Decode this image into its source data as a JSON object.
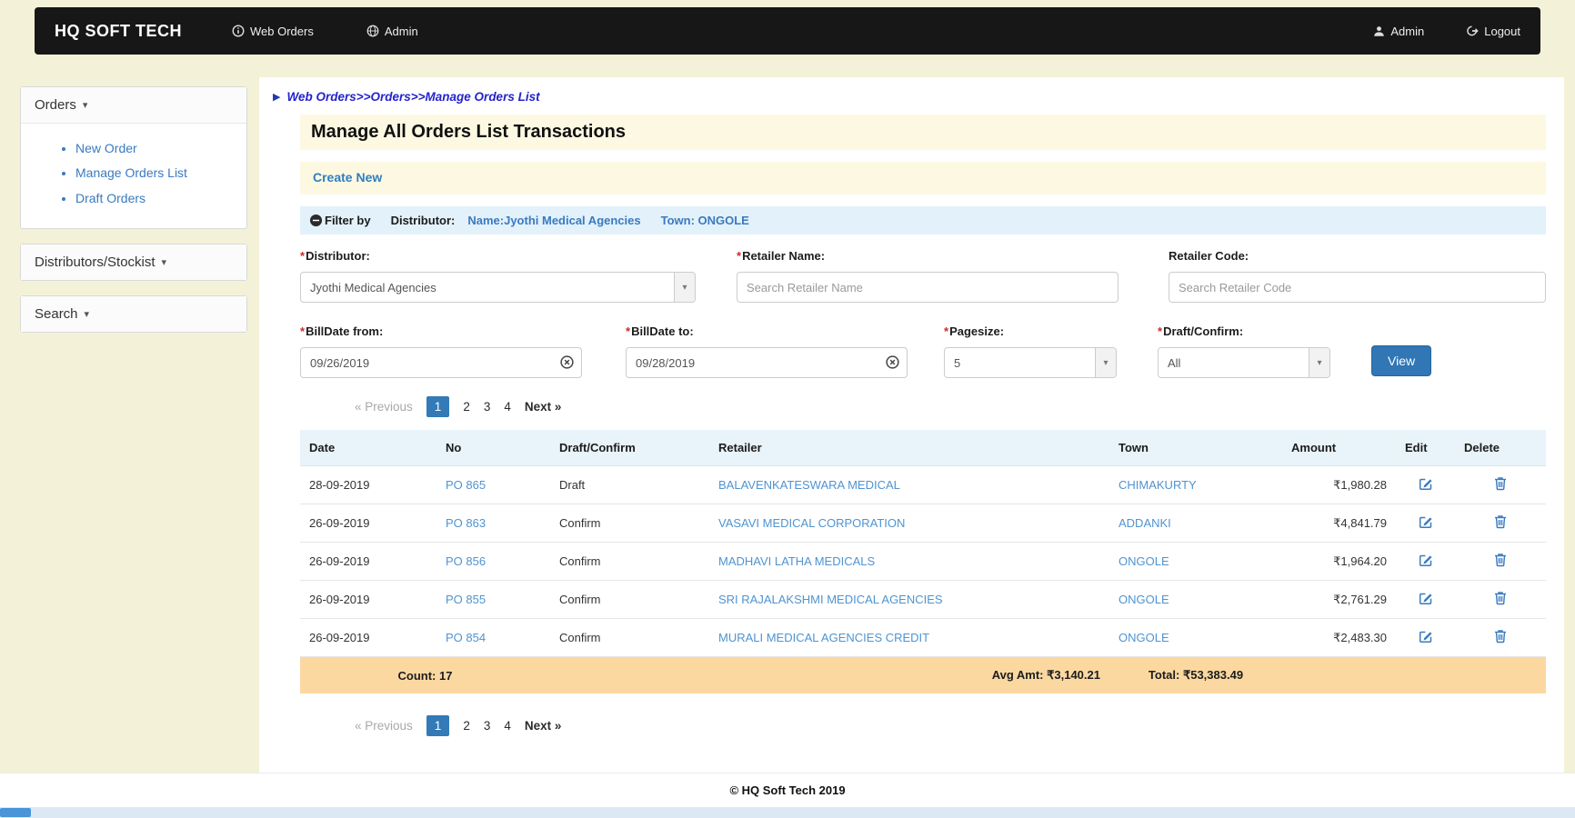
{
  "colors": {
    "accent": "#337ab7",
    "navbar_bg": "#171717",
    "page_bg": "#f3f2d8",
    "strip_bg": "#fdf8e1",
    "filter_bg": "#e3f1fa",
    "table_header_bg": "#e8f3fa",
    "summary_row_bg": "#fcd8a1",
    "link": "#4f94d0",
    "required_mark_color": "#cc2a2a"
  },
  "icons": {
    "caret_down": "▾",
    "breadcrumb_arrow": "▶"
  },
  "navbar": {
    "brand": "HQ SOFT TECH",
    "web_orders": "Web Orders",
    "admin_menu": "Admin",
    "admin_user": "Admin",
    "logout": "Logout"
  },
  "sidebar": {
    "orders": {
      "title": "Orders",
      "items": [
        {
          "label": "New Order"
        },
        {
          "label": "Manage Orders List"
        },
        {
          "label": "Draft Orders"
        }
      ]
    },
    "distributors": {
      "title": "Distributors/Stockist"
    },
    "search": {
      "title": "Search"
    }
  },
  "breadcrumb": "Web Orders>>Orders>>Manage Orders List",
  "page": {
    "title": "Manage All Orders List Transactions",
    "create_new": "Create New"
  },
  "filter": {
    "label": "Filter by",
    "distributor_label": "Distributor:",
    "name_value": "Name:Jyothi Medical Agencies",
    "town_value": "Town: ONGOLE"
  },
  "form": {
    "required_mark": "*",
    "distributor": {
      "label": "Distributor:",
      "value": "Jyothi Medical Agencies"
    },
    "retailer_name": {
      "label": "Retailer Name:",
      "placeholder": "Search Retailer Name"
    },
    "retailer_code": {
      "label": "Retailer Code:",
      "placeholder": "Search Retailer Code"
    },
    "bill_date_from": {
      "label": "BillDate from:",
      "value": "09/26/2019"
    },
    "bill_date_to": {
      "label": "BillDate to:",
      "value": "09/28/2019"
    },
    "pagesize": {
      "label": "Pagesize:",
      "value": "5"
    },
    "draft_confirm": {
      "label": "Draft/Confirm:",
      "value": "All"
    },
    "view_button": "View"
  },
  "pagination": {
    "previous": "« Previous",
    "pages": [
      "1",
      "2",
      "3",
      "4"
    ],
    "next": "Next »",
    "active_page": "1"
  },
  "orders_table": {
    "headers": [
      "Date",
      "No",
      "Draft/Confirm",
      "Retailer",
      "Town",
      "Amount",
      "Edit",
      "Delete"
    ],
    "rows": [
      {
        "date": "28-09-2019",
        "no": "PO 865",
        "status": "Draft",
        "retailer": "BALAVENKATESWARA MEDICAL",
        "town": "CHIMAKURTY",
        "amount": "₹1,980.28"
      },
      {
        "date": "26-09-2019",
        "no": "PO 863",
        "status": "Confirm",
        "retailer": "VASAVI MEDICAL CORPORATION",
        "town": "ADDANKI",
        "amount": "₹4,841.79"
      },
      {
        "date": "26-09-2019",
        "no": "PO 856",
        "status": "Confirm",
        "retailer": "MADHAVI LATHA MEDICALS",
        "town": "ONGOLE",
        "amount": "₹1,964.20"
      },
      {
        "date": "26-09-2019",
        "no": "PO 855",
        "status": "Confirm",
        "retailer": "SRI RAJALAKSHMI MEDICAL AGENCIES",
        "town": "ONGOLE",
        "amount": "₹2,761.29"
      },
      {
        "date": "26-09-2019",
        "no": "PO 854",
        "status": "Confirm",
        "retailer": "MURALI MEDICAL AGENCIES CREDIT",
        "town": "ONGOLE",
        "amount": "₹2,483.30"
      }
    ],
    "summary": {
      "count": "Count: 17",
      "avg": "Avg Amt: ₹3,140.21",
      "total": "Total: ₹53,383.49"
    }
  },
  "footer": {
    "copyright": "© HQ Soft Tech 2019"
  }
}
